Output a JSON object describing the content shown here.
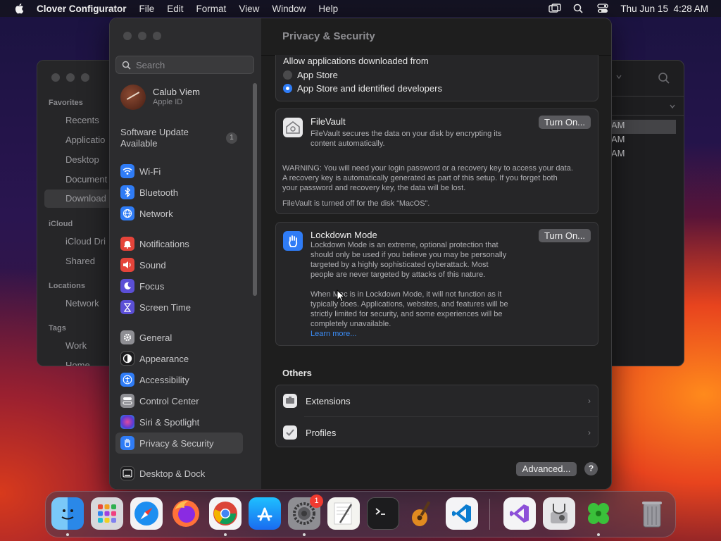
{
  "menubar": {
    "app_name": "Clover Configurator",
    "menus": [
      "File",
      "Edit",
      "Format",
      "View",
      "Window",
      "Help"
    ],
    "clock": "Thu Jun 15  4:28 AM"
  },
  "finder": {
    "favorites_label": "Favorites",
    "favorites": [
      "Recents",
      "Applicatio",
      "Desktop",
      "Document",
      "Download"
    ],
    "icloud_label": "iCloud",
    "icloud": [
      "iCloud Dri",
      "Shared"
    ],
    "locations_label": "Locations",
    "locations": [
      "Network"
    ],
    "tags_label": "Tags",
    "tags": [
      "Work",
      "Home"
    ],
    "times": [
      "AM",
      "AM",
      "AM"
    ]
  },
  "settings": {
    "title": "Privacy & Security",
    "search_placeholder": "Search",
    "account": {
      "name": "Calub Viem",
      "sub": "Apple ID"
    },
    "software_update": "Software Update Available",
    "software_update_count": "1",
    "sidebar_items": [
      {
        "label": "Wi-Fi",
        "icon": "wifi-icon",
        "color": "#2f7cf6"
      },
      {
        "label": "Bluetooth",
        "icon": "bluetooth-icon",
        "color": "#2f7cf6"
      },
      {
        "label": "Network",
        "icon": "globe-icon",
        "color": "#2f7cf6"
      },
      {
        "label": "Notifications",
        "icon": "bell-icon",
        "color": "#e5443a"
      },
      {
        "label": "Sound",
        "icon": "speaker-icon",
        "color": "#e5443a"
      },
      {
        "label": "Focus",
        "icon": "moon-icon",
        "color": "#5b4fd6"
      },
      {
        "label": "Screen Time",
        "icon": "hourglass-icon",
        "color": "#5b4fd6"
      },
      {
        "label": "General",
        "icon": "gear-icon",
        "color": "#8e8e93"
      },
      {
        "label": "Appearance",
        "icon": "appearance-icon",
        "color": "#2c2c2e"
      },
      {
        "label": "Accessibility",
        "icon": "accessibility-icon",
        "color": "#2f7cf6"
      },
      {
        "label": "Control Center",
        "icon": "control-center-icon",
        "color": "#8e8e93"
      },
      {
        "label": "Siri & Spotlight",
        "icon": "siri-icon",
        "color": "#9a4fd6"
      },
      {
        "label": "Privacy & Security",
        "icon": "hand-icon",
        "color": "#2f7cf6"
      },
      {
        "label": "Desktop & Dock",
        "icon": "dock-icon",
        "color": "#2c2c2e"
      }
    ],
    "allow_title": "Allow applications downloaded from",
    "allow_options": [
      "App Store",
      "App Store and identified developers"
    ],
    "allow_selected": 1,
    "filevault": {
      "title": "FileVault",
      "desc_line1": "FileVault secures the data on your disk by encrypting its",
      "desc_line2": "content automatically.",
      "button": "Turn On...",
      "warning_line1": "WARNING: You will need your login password or a recovery key to access your data.",
      "warning_line2": "A recovery key is automatically generated as part of this setup. If you forget both",
      "warning_line3": "your password and recovery key, the data will be lost.",
      "status": "FileVault is turned off for the disk “MacOS”."
    },
    "lockdown": {
      "title": "Lockdown Mode",
      "button": "Turn On...",
      "desc": [
        "Lockdown Mode is an extreme, optional protection that",
        "should only be used if you believe you may be personally",
        "targeted by a highly sophisticated cyberattack. Most",
        "people are never targeted by attacks of this nature."
      ],
      "desc2": [
        "When Mac is in Lockdown Mode, it will not function as it",
        "typically does. Applications, websites, and features will be",
        "strictly limited for security, and some experiences will be",
        "completely unavailable."
      ],
      "learn_more": "Learn more..."
    },
    "others_title": "Others",
    "others": [
      "Extensions",
      "Profiles"
    ],
    "advanced_button": "Advanced...",
    "help_button": "?"
  },
  "dock": {
    "apps": [
      "Finder",
      "Launchpad",
      "Safari",
      "Firefox",
      "Chrome",
      "App Store",
      "System Settings",
      "TextEdit",
      "Terminal",
      "GarageBand",
      "Visual Studio Code",
      "Visual Studio",
      "Disk Utility",
      "Clover Configurator",
      "Trash"
    ],
    "settings_badge": "1"
  }
}
